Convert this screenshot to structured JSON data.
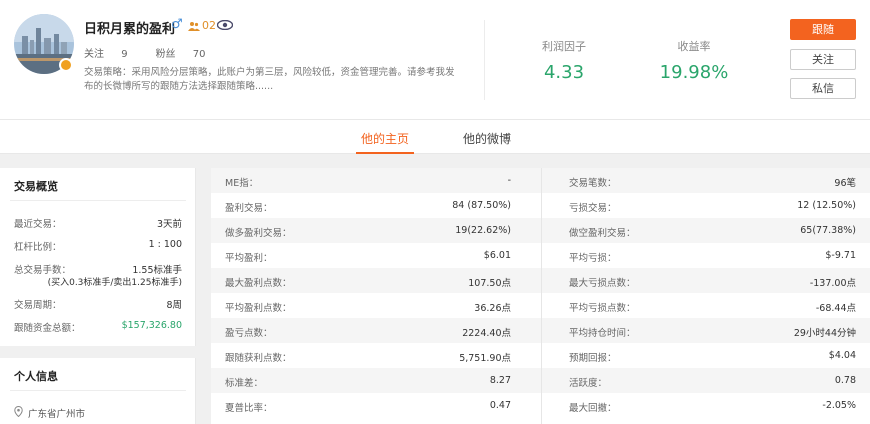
{
  "profile": {
    "name": "日积月累的盈利",
    "gender_symbol": "♂",
    "people_count": "02",
    "follows_label": "关注",
    "follows_value": "9",
    "fans_label": "粉丝",
    "fans_value": "70",
    "strategy_text": "交易策略：采用风险分层策略，此账户为第三层，风险较低，资金管理完善。请参考我发布的长微博所写的跟随方法选择跟随策略......"
  },
  "metrics": [
    {
      "label": "利润因子",
      "value": "4.33"
    },
    {
      "label": "收益率",
      "value": "19.98%"
    }
  ],
  "actions": {
    "follow_trade": "跟随",
    "follow": "关注",
    "message": "私信"
  },
  "tabs": [
    {
      "label": "他的主页",
      "active": true
    },
    {
      "label": "他的微博",
      "active": false
    }
  ],
  "overview": {
    "title": "交易概览",
    "rows": [
      {
        "label": "最近交易：",
        "value": "3天前"
      },
      {
        "label": "杠杆比例：",
        "value": "1 : 100"
      },
      {
        "label": "总交易手数：",
        "value": "1.55标准手",
        "value2": "(买入0.3标准手/卖出1.25标准手)"
      },
      {
        "label": "交易周期：",
        "value": "8周"
      },
      {
        "label": "跟随资金总额：",
        "value": "$157,326.80"
      }
    ]
  },
  "personal": {
    "title": "个人信息",
    "location": "广东省广州市"
  },
  "stats": {
    "left": [
      {
        "label": "ME指：",
        "value": "-"
      },
      {
        "label": "盈利交易：",
        "value": "84 (87.50%)"
      },
      {
        "label": "做多盈利交易：",
        "value": "19(22.62%)"
      },
      {
        "label": "平均盈利：",
        "value": "$6.01"
      },
      {
        "label": "最大盈利点数：",
        "value": "107.50点"
      },
      {
        "label": "平均盈利点数：",
        "value": "36.26点"
      },
      {
        "label": "盈亏点数：",
        "value": "2224.40点"
      },
      {
        "label": "跟随获利点数：",
        "value": "5,751.90点"
      },
      {
        "label": "标准差：",
        "value": "8.27"
      },
      {
        "label": "夏普比率：",
        "value": "0.47"
      }
    ],
    "right": [
      {
        "label": "交易笔数：",
        "value": "96笔"
      },
      {
        "label": "亏损交易：",
        "value": "12 (12.50%)"
      },
      {
        "label": "做空盈利交易：",
        "value": "65(77.38%)"
      },
      {
        "label": "平均亏损：",
        "value": "$-9.71"
      },
      {
        "label": "最大亏损点数：",
        "value": "-137.00点"
      },
      {
        "label": "平均亏损点数：",
        "value": "-68.44点"
      },
      {
        "label": "平均持仓时间：",
        "value": "29小时44分钟"
      },
      {
        "label": "预期回报：",
        "value": "$4.04"
      },
      {
        "label": "活跃度：",
        "value": "0.78"
      },
      {
        "label": "最大回撤：",
        "value": "-2.05%"
      }
    ]
  },
  "colors": {
    "accent": "#f3631f",
    "positive": "#2aa56b"
  }
}
